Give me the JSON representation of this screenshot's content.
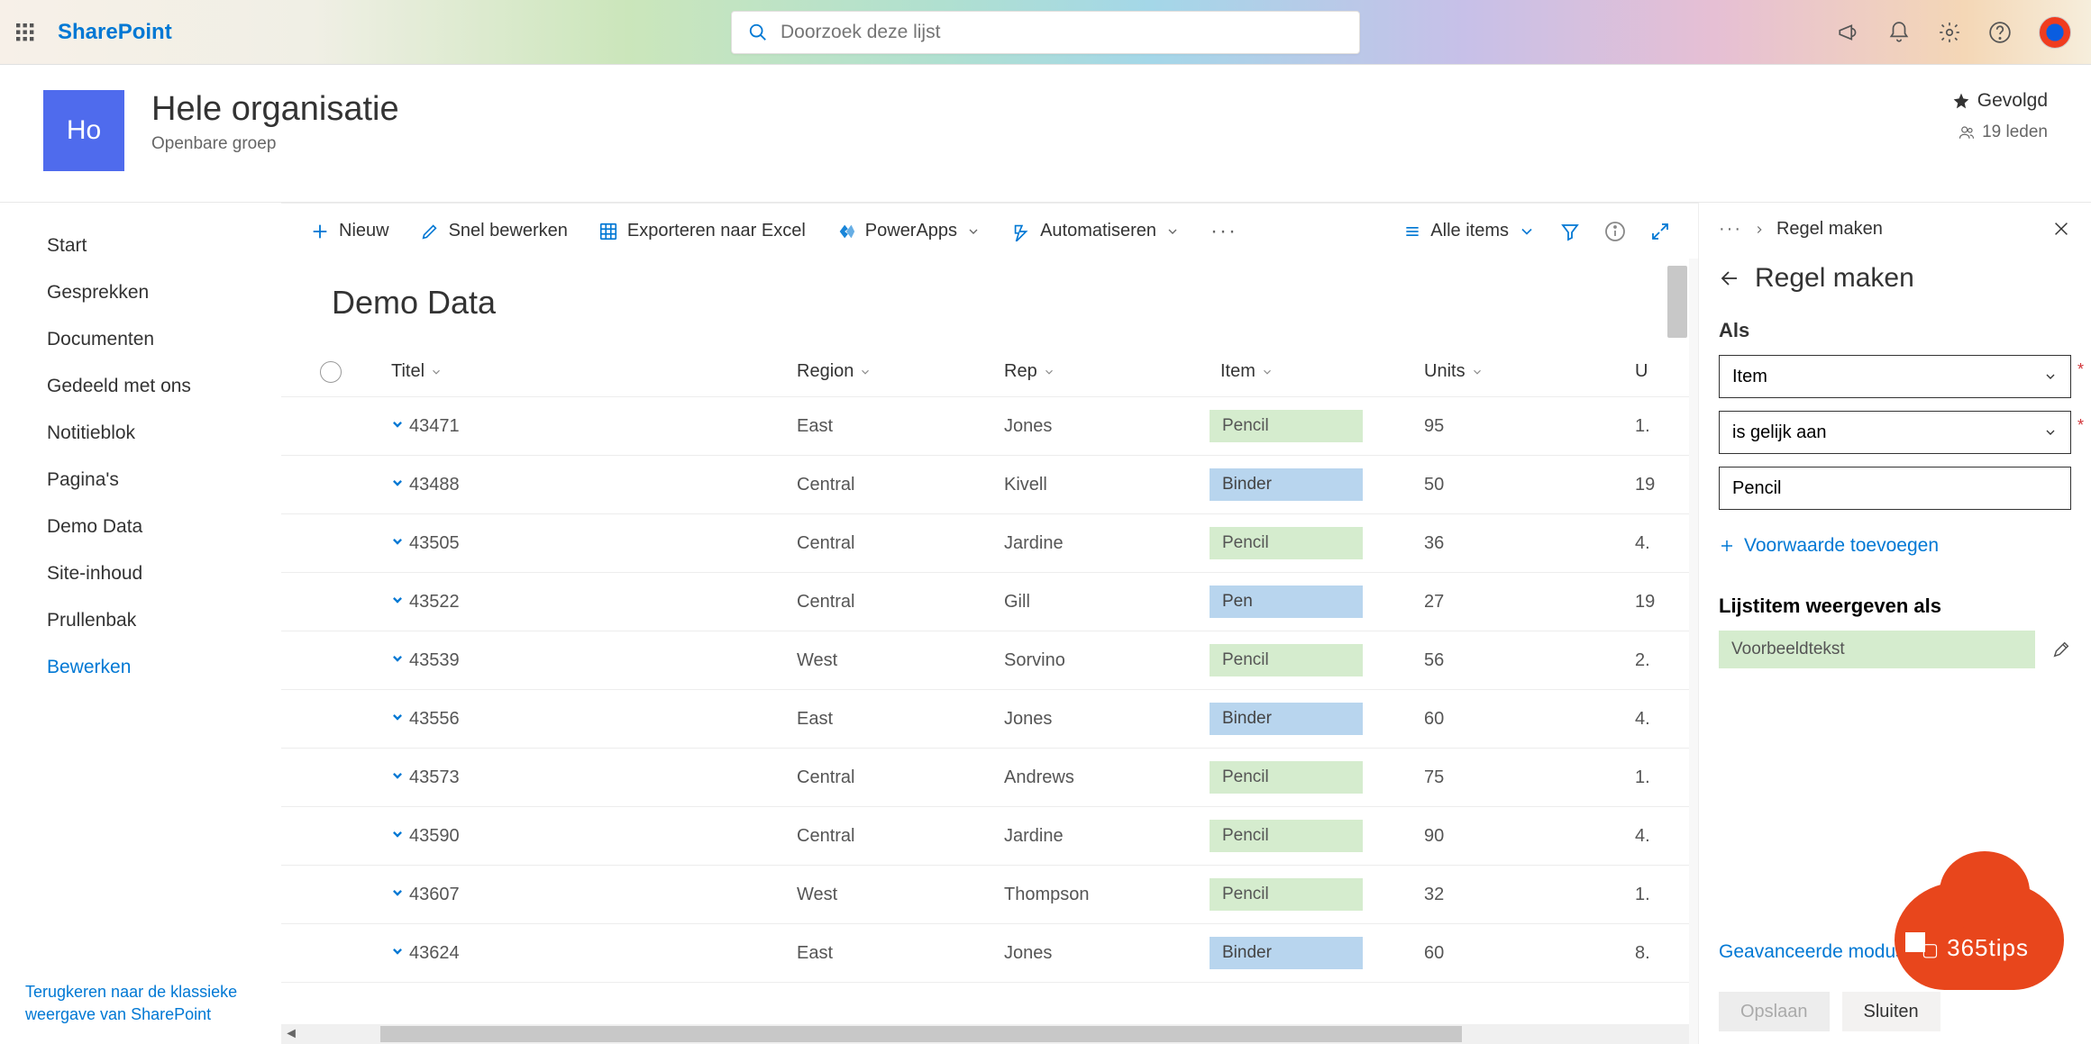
{
  "header": {
    "brand": "SharePoint",
    "search_placeholder": "Doorzoek deze lijst"
  },
  "site": {
    "logo_initials": "Ho",
    "title": "Hele organisatie",
    "subtitle": "Openbare groep",
    "followed_label": "Gevolgd",
    "members_label": "19 leden"
  },
  "nav": {
    "items": [
      "Start",
      "Gesprekken",
      "Documenten",
      "Gedeeld met ons",
      "Notitieblok",
      "Pagina's",
      "Demo Data",
      "Site-inhoud",
      "Prullenbak"
    ],
    "edit_label": "Bewerken",
    "classic_label": "Terugkeren naar de klassieke weergave van SharePoint"
  },
  "commands": {
    "new": "Nieuw",
    "quickedit": "Snel bewerken",
    "export": "Exporteren naar Excel",
    "powerapps": "PowerApps",
    "automate": "Automatiseren",
    "view": "Alle items"
  },
  "list": {
    "title": "Demo Data",
    "columns": {
      "titel": "Titel",
      "region": "Region",
      "rep": "Rep",
      "item": "Item",
      "units": "Units",
      "unit": "U"
    },
    "rows": [
      {
        "titel": "43471",
        "region": "East",
        "rep": "Jones",
        "item": "Pencil",
        "item_color": "green",
        "units": "95",
        "unit": "1."
      },
      {
        "titel": "43488",
        "region": "Central",
        "rep": "Kivell",
        "item": "Binder",
        "item_color": "blue",
        "units": "50",
        "unit": "19"
      },
      {
        "titel": "43505",
        "region": "Central",
        "rep": "Jardine",
        "item": "Pencil",
        "item_color": "green",
        "units": "36",
        "unit": "4."
      },
      {
        "titel": "43522",
        "region": "Central",
        "rep": "Gill",
        "item": "Pen",
        "item_color": "blue",
        "units": "27",
        "unit": "19"
      },
      {
        "titel": "43539",
        "region": "West",
        "rep": "Sorvino",
        "item": "Pencil",
        "item_color": "green",
        "units": "56",
        "unit": "2."
      },
      {
        "titel": "43556",
        "region": "East",
        "rep": "Jones",
        "item": "Binder",
        "item_color": "blue",
        "units": "60",
        "unit": "4."
      },
      {
        "titel": "43573",
        "region": "Central",
        "rep": "Andrews",
        "item": "Pencil",
        "item_color": "green",
        "units": "75",
        "unit": "1."
      },
      {
        "titel": "43590",
        "region": "Central",
        "rep": "Jardine",
        "item": "Pencil",
        "item_color": "green",
        "units": "90",
        "unit": "4."
      },
      {
        "titel": "43607",
        "region": "West",
        "rep": "Thompson",
        "item": "Pencil",
        "item_color": "green",
        "units": "32",
        "unit": "1."
      },
      {
        "titel": "43624",
        "region": "East",
        "rep": "Jones",
        "item": "Binder",
        "item_color": "blue",
        "units": "60",
        "unit": "8."
      }
    ]
  },
  "panel": {
    "breadcrumb_current": "Regel maken",
    "title": "Regel maken",
    "section_if": "Als",
    "field_column": "Item",
    "field_operator": "is gelijk aan",
    "field_value": "Pencil",
    "add_condition": "Voorwaarde toevoegen",
    "section_display": "Lijstitem weergeven als",
    "preview_text": "Voorbeeldtekst",
    "advanced": "Geavanceerde modus",
    "save": "Opslaan",
    "close": "Sluiten"
  },
  "watermark": "365tips"
}
